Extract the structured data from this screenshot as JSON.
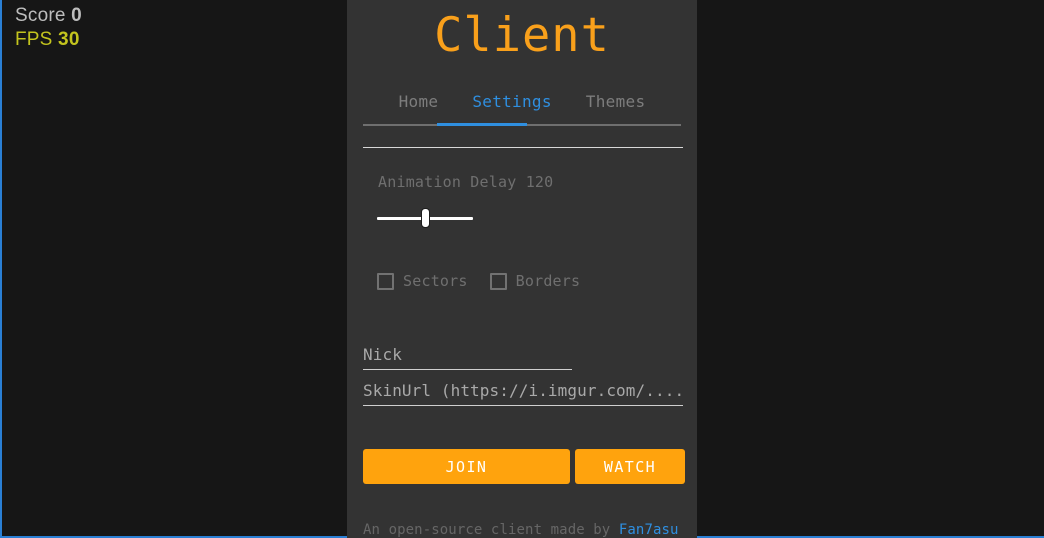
{
  "hud": {
    "score_label": "Score",
    "score_value": "0",
    "fps_label": "FPS",
    "fps_value": "30"
  },
  "panel": {
    "title": "Client",
    "tabs": [
      {
        "label": "Home",
        "active": false
      },
      {
        "label": "Settings",
        "active": true
      },
      {
        "label": "Themes",
        "active": false
      }
    ],
    "settings": {
      "animation_delay_label": "Animation Delay 120",
      "animation_delay_value": "120",
      "checkboxes": [
        {
          "label": "Sectors",
          "checked": false
        },
        {
          "label": "Borders",
          "checked": false
        }
      ],
      "nick_placeholder": "Nick",
      "nick_value": "",
      "skin_placeholder": "SkinUrl (https://i.imgur.com/........)",
      "skin_value": ""
    },
    "buttons": {
      "join_label": "JOIN",
      "watch_label": "WATCH"
    },
    "footer": {
      "text_prefix": "An open-source client made by ",
      "link_label": "Fan7asu"
    }
  },
  "colors": {
    "accent_orange": "#ffa30d",
    "accent_blue": "#2f8fe0",
    "panel_background": "#333333",
    "game_background": "#161616",
    "fps_yellow": "#c3c41e"
  }
}
